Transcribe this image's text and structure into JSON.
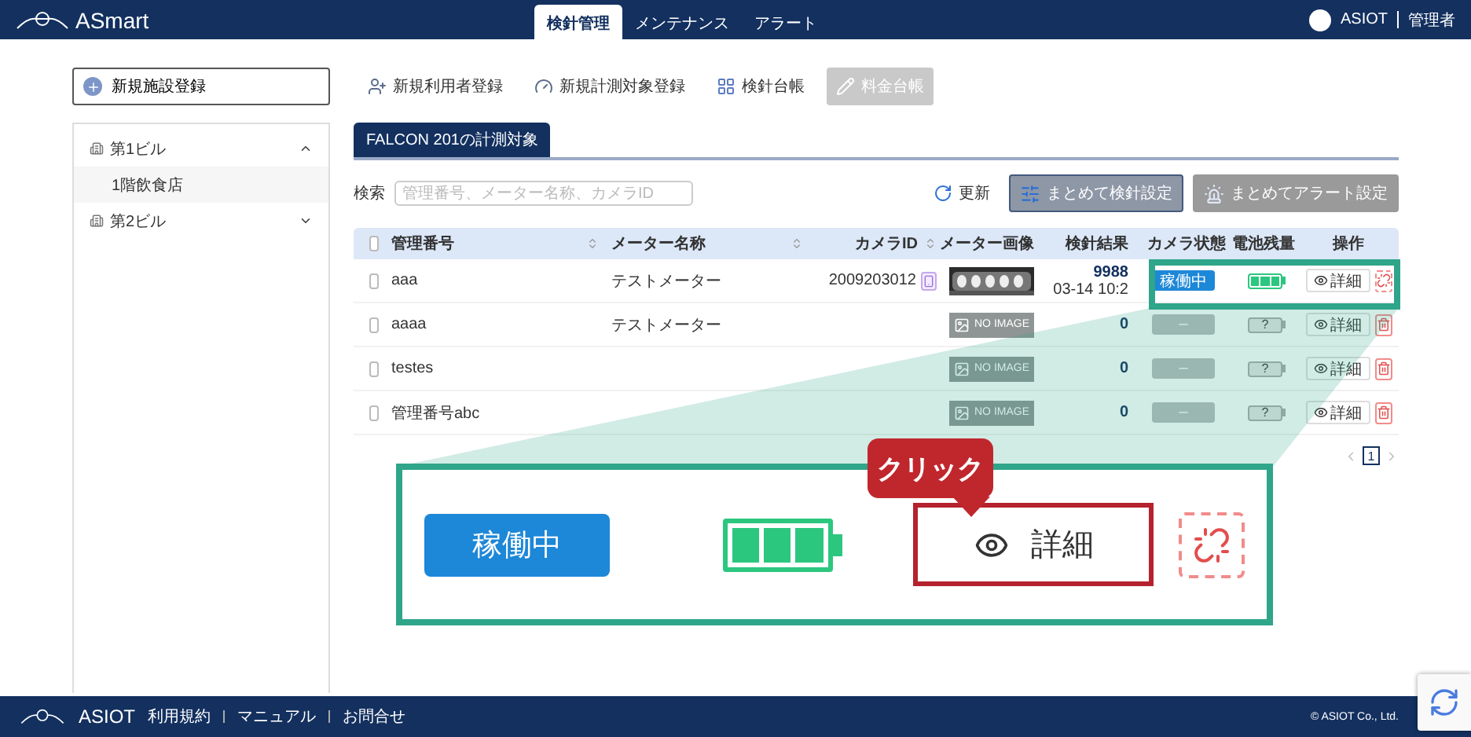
{
  "header": {
    "logo": "ASmart",
    "nav_tabs": [
      {
        "label": "検針管理",
        "selected": true
      },
      {
        "label": "メンテナンス",
        "selected": false
      },
      {
        "label": "アラート",
        "selected": false
      }
    ],
    "user": {
      "name": "ASIOT",
      "role": "管理者"
    }
  },
  "toolbar": {
    "new_facility": "新規施設登録",
    "actions": [
      {
        "label": "新規利用者登録",
        "kind": "user",
        "disabled": false
      },
      {
        "label": "新規計測対象登録",
        "kind": "meter",
        "disabled": false
      },
      {
        "label": "検針台帳",
        "kind": "ledger",
        "disabled": false
      },
      {
        "label": "料金台帳",
        "kind": "pencil",
        "disabled": true
      }
    ]
  },
  "sidebar": {
    "items": [
      {
        "label": "第1ビル",
        "expanded": true,
        "children": [
          {
            "label": "1階飲食店"
          }
        ]
      },
      {
        "label": "第2ビル",
        "expanded": false
      }
    ]
  },
  "panel": {
    "tab": "FALCON 201の計測対象",
    "search": {
      "label": "検索",
      "placeholder": "管理番号、メーター名称、カメラID"
    },
    "refresh": "更新",
    "batch_buttons": [
      {
        "label": "まとめて検針設定",
        "kind": "sliders",
        "disabled": false
      },
      {
        "label": "まとめてアラート設定",
        "kind": "alarm",
        "disabled": true
      }
    ]
  },
  "table": {
    "header_checked": false,
    "columns": [
      {
        "label": "管理番号",
        "sortable": true
      },
      {
        "label": "メーター名称",
        "sortable": true
      },
      {
        "label": "カメラID",
        "sortable": true
      },
      {
        "label": "メーター画像",
        "sortable": false
      },
      {
        "label": "検針結果",
        "sortable": false
      },
      {
        "label": "カメラ状態",
        "sortable": false
      },
      {
        "label": "電池残量",
        "sortable": false
      },
      {
        "label": "操作",
        "sortable": false
      }
    ],
    "rows": [
      {
        "checked": false,
        "id": "aaa",
        "meter_name": "テストメーター",
        "camera_id": "2009203012",
        "result": "9988",
        "result_time": "03-14 10:2",
        "camera_status": {
          "kind": "active",
          "label": "稼働中"
        },
        "battery": {
          "kind": "full"
        },
        "detail": "詳細",
        "action": {
          "kind": "unlink"
        }
      },
      {
        "checked": false,
        "id": "aaaa",
        "meter_name": "テストメーター",
        "image": {
          "kind": "none",
          "label": "NO IMAGE"
        },
        "result": "0",
        "camera_status": {
          "kind": "unknown",
          "label": "–"
        },
        "battery": {
          "kind": "unknown",
          "label": "?"
        },
        "detail": "詳細",
        "action": {
          "kind": "delete"
        }
      },
      {
        "checked": false,
        "id": "testes",
        "image": {
          "kind": "none",
          "label": "NO IMAGE"
        },
        "result": "0",
        "camera_status": {
          "kind": "unknown",
          "label": "–"
        },
        "battery": {
          "kind": "unknown",
          "label": "?"
        },
        "detail": "詳細",
        "action": {
          "kind": "delete"
        }
      },
      {
        "checked": false,
        "id": "管理番号abc",
        "image": {
          "kind": "none",
          "label": "NO IMAGE"
        },
        "result": "0",
        "camera_status": {
          "kind": "unknown",
          "label": "–"
        },
        "battery": {
          "kind": "unknown",
          "label": "?"
        },
        "detail": "詳細",
        "action": {
          "kind": "delete"
        }
      }
    ]
  },
  "pagination": {
    "page": "1"
  },
  "callout": {
    "label": "クリック",
    "status_label": "稼働中",
    "battery": {
      "kind": "full"
    },
    "detail": "詳細",
    "action": {
      "kind": "unlink"
    }
  },
  "footer": {
    "logo": "ASIOT",
    "links": [
      "利用規約",
      "マニュアル",
      "お問合せ"
    ],
    "copyright": "© ASIOT Co., Ltd."
  }
}
